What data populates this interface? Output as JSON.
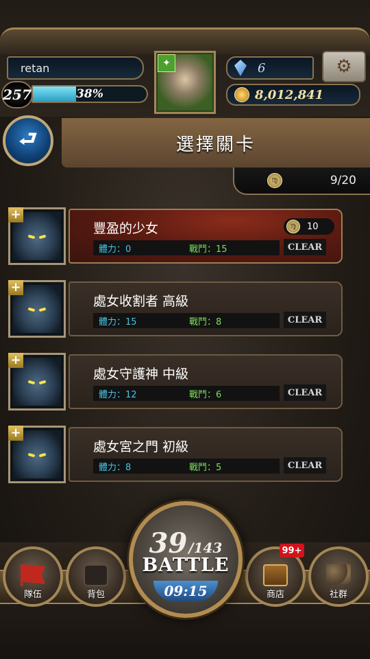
{
  "player": {
    "name": "retan",
    "level": "257",
    "exp_percent": 38,
    "exp_label": "38%",
    "gems": "6",
    "gold": "8,012,841"
  },
  "header": {
    "title": "選擇關卡",
    "progress": "9/20"
  },
  "stages": [
    {
      "name": "豐盈的少女",
      "stamina": "體力：0",
      "battle": "戰鬥：15",
      "status": "CLEAR",
      "reward": "10",
      "active": true
    },
    {
      "name": "處女收割者 高級",
      "stamina": "體力：15",
      "battle": "戰鬥：8",
      "status": "CLEAR"
    },
    {
      "name": "處女守護神 中級",
      "stamina": "體力：12",
      "battle": "戰鬥：6",
      "status": "CLEAR"
    },
    {
      "name": "處女宮之門 初級",
      "stamina": "體力：8",
      "battle": "戰鬥：5",
      "status": "CLEAR"
    }
  ],
  "battle": {
    "current": "39",
    "max": "/143",
    "label": "BATTLE",
    "timer": "09:15"
  },
  "nav": {
    "team": "隊伍",
    "bag": "背包",
    "shop": "商店",
    "shop_badge": "99+",
    "social": "社群"
  },
  "colors": {
    "stamina_text": "#46c5e5",
    "battle_text": "#7be05a",
    "frame_gold": "#a38656"
  }
}
